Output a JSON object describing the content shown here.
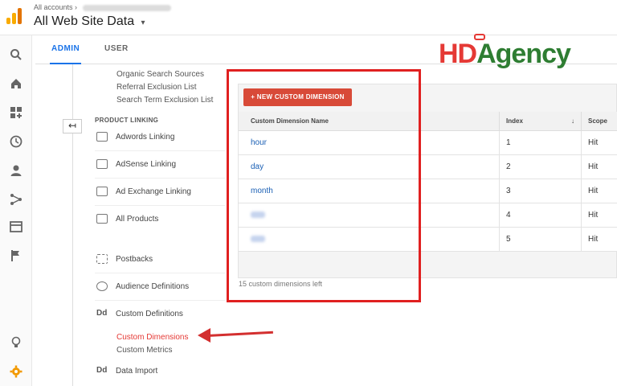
{
  "header": {
    "breadcrumb": "All accounts",
    "site_title": "All Web Site Data",
    "caret": "▾"
  },
  "brand": {
    "hd": "HD",
    "agency": "Agency"
  },
  "tabs": {
    "admin": "ADMIN",
    "user": "USER"
  },
  "nav": {
    "links_top": [
      "Organic Search Sources",
      "Referral Exclusion List",
      "Search Term Exclusion List"
    ],
    "section_product_linking": "PRODUCT LINKING",
    "rows": [
      "Adwords Linking",
      "AdSense Linking",
      "Ad Exchange Linking",
      "All Products",
      "Postbacks",
      "Audience Definitions",
      "Custom Definitions"
    ],
    "dd_glyph": "Dd",
    "sub_items": [
      "Custom Dimensions",
      "Custom Metrics"
    ],
    "data_import": "Data Import"
  },
  "main": {
    "new_button": "+ NEW CUSTOM DIMENSION",
    "columns": [
      "Custom Dimension Name",
      "Index",
      "Scope"
    ],
    "sort_glyph": "↓",
    "rows": [
      {
        "name": "hour",
        "index": "1",
        "scope": "Hit"
      },
      {
        "name": "day",
        "index": "2",
        "scope": "Hit"
      },
      {
        "name": "month",
        "index": "3",
        "scope": "Hit"
      },
      {
        "name": "",
        "index": "4",
        "scope": "Hit"
      },
      {
        "name": "",
        "index": "5",
        "scope": "Hit"
      }
    ],
    "footer": "15 custom dimensions left"
  },
  "colors": {
    "accent": "#1a73e8",
    "danger": "#d84a38",
    "highlight": "#e02020"
  }
}
